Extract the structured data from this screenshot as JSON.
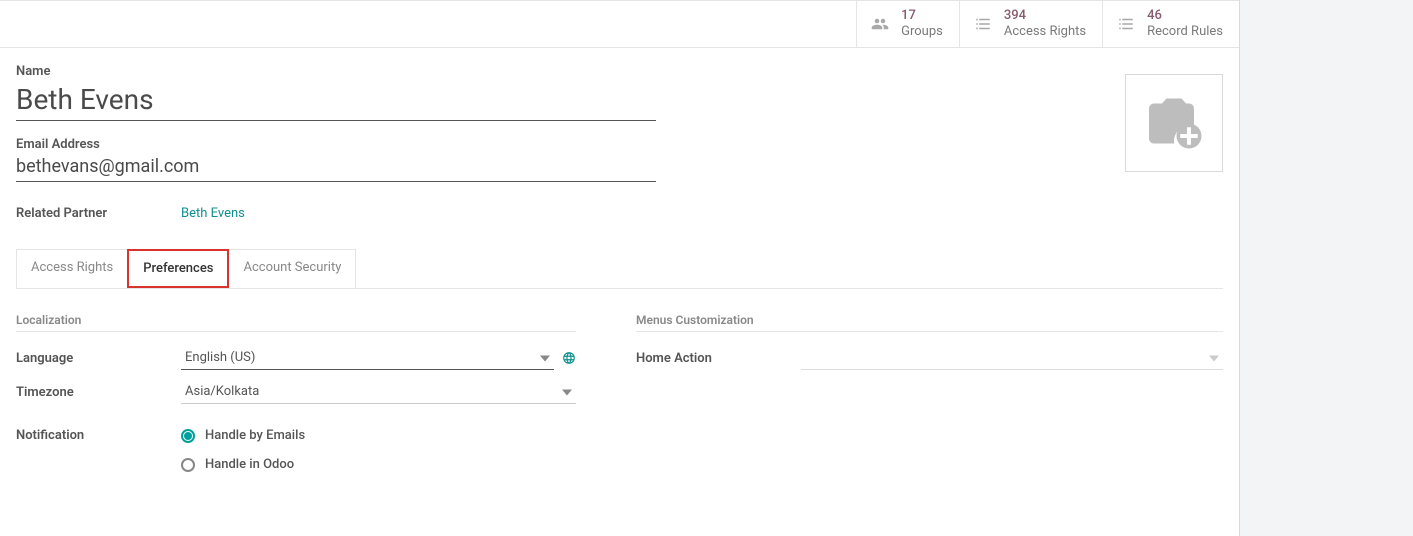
{
  "stats": {
    "groups": {
      "count": "17",
      "label": "Groups"
    },
    "accessRights": {
      "count": "394",
      "label": "Access Rights"
    },
    "recordRules": {
      "count": "46",
      "label": "Record Rules"
    }
  },
  "fields": {
    "nameLabel": "Name",
    "nameValue": "Beth Evens",
    "emailLabel": "Email Address",
    "emailValue": "bethevans@gmail.com",
    "partnerLabel": "Related Partner",
    "partnerLink": "Beth Evens"
  },
  "tabs": {
    "accessRights": "Access Rights",
    "preferences": "Preferences",
    "accountSecurity": "Account Security"
  },
  "sections": {
    "localization": "Localization",
    "menusCustomization": "Menus Customization"
  },
  "form": {
    "languageLabel": "Language",
    "languageValue": "English (US)",
    "timezoneLabel": "Timezone",
    "timezoneValue": "Asia/Kolkata",
    "notificationLabel": "Notification",
    "homeActionLabel": "Home Action",
    "homeActionValue": ""
  },
  "notificationOptions": {
    "email": "Handle by Emails",
    "odoo": "Handle in Odoo"
  }
}
